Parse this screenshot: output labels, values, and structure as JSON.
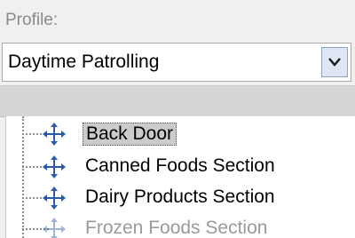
{
  "profile": {
    "label": "Profile:",
    "selected_value": "Daytime Patrolling"
  },
  "tree": {
    "items": [
      {
        "label": "Back Door",
        "icon": "ptz-move-icon",
        "selected": true
      },
      {
        "label": "Canned Foods Section",
        "icon": "ptz-move-icon",
        "selected": false
      },
      {
        "label": "Dairy Products Section",
        "icon": "ptz-move-icon",
        "selected": false
      },
      {
        "label": "Frozen Foods Section",
        "icon": "ptz-move-icon",
        "selected": false
      }
    ]
  },
  "colors": {
    "selection": "#cbcbcb",
    "dropdown_button": "#dde6f2",
    "icon_blue": "#2a5aa8"
  }
}
